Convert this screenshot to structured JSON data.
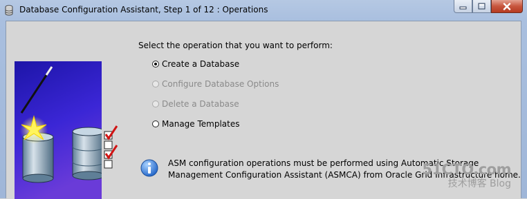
{
  "window": {
    "title": "Database Configuration Assistant, Step 1 of 12 : Operations",
    "minimize_icon": "minimize-icon",
    "maximize_icon": "maximize-icon",
    "close_icon": "close-icon"
  },
  "content": {
    "prompt": "Select the operation that you want to perform:",
    "options": [
      {
        "label": "Create a Database",
        "selected": true,
        "enabled": true
      },
      {
        "label": "Configure Database Options",
        "selected": false,
        "enabled": false
      },
      {
        "label": "Delete a Database",
        "selected": false,
        "enabled": false
      },
      {
        "label": "Manage Templates",
        "selected": false,
        "enabled": true
      }
    ],
    "info": {
      "icon": "info-icon",
      "line1": "ASM configuration operations must be performed using Automatic Storage",
      "line2": "Management Configuration Assistant (ASMCA) from Oracle Grid Infrastructure home."
    }
  },
  "watermark": {
    "main": "51CTO.com",
    "sub": "技术博客  Blog"
  },
  "colors": {
    "window_bg": "#d6d6d6",
    "title_bar": "#b5c8e3",
    "close_button": "#c7563e",
    "disabled_text": "#8a8a8a"
  }
}
